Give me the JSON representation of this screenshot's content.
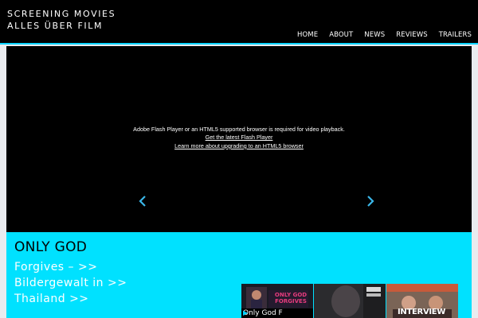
{
  "site": {
    "title_line1": "SCREENING MOVIES",
    "title_line2": "ALLES ÜBER FILM"
  },
  "nav": {
    "items": [
      {
        "label": "HOME"
      },
      {
        "label": "ABOUT"
      },
      {
        "label": "NEWS"
      },
      {
        "label": "REVIEWS"
      },
      {
        "label": "TRAILERS"
      }
    ]
  },
  "player": {
    "message": "Adobe Flash Player or an HTML5 supported browser is required for video playback.",
    "link_flash": "Get the latest Flash Player",
    "link_html5": "Learn more about upgrading to an HTML5 browser",
    "prev_icon": "chevron-left-icon",
    "next_icon": "chevron-right-icon"
  },
  "caption": {
    "title": "ONLY GOD",
    "lines": [
      "Forgives –  >>",
      "Bildergewalt in  >>",
      "Thailand  >>"
    ]
  },
  "thumbnails": [
    {
      "label": "Only God F",
      "poster_text": "ONLY GOD FORGIVES"
    },
    {
      "label": ""
    },
    {
      "label": "",
      "poster_text": "INTERVIEW"
    }
  ],
  "colors": {
    "accent": "#00d4ff",
    "caption_bg": "#00e1ff",
    "arrow": "#3ab6e8"
  }
}
